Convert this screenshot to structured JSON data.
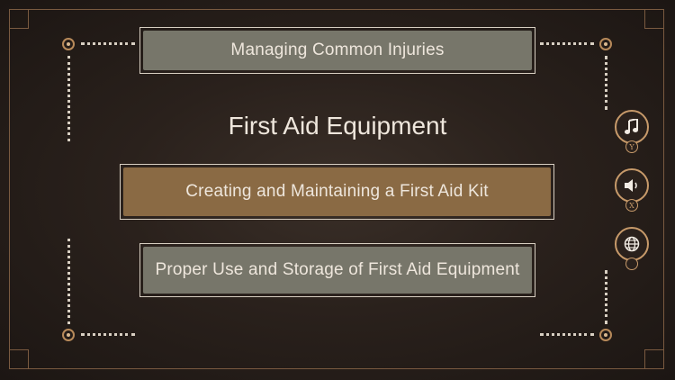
{
  "menu": {
    "category_title": "First Aid Equipment",
    "items": [
      {
        "label": "Managing Common Injuries",
        "state": "partial"
      },
      {
        "label": "Creating and Maintaining a First Aid Kit",
        "state": "selected"
      },
      {
        "label": "Proper Use and Storage of First Aid Equipment",
        "state": "normal"
      }
    ]
  },
  "side_controls": [
    {
      "icon": "music-note-icon",
      "key_hint": "Y"
    },
    {
      "icon": "speaker-icon",
      "key_hint": "X"
    },
    {
      "icon": "globe-icon",
      "key_hint": ""
    }
  ],
  "colors": {
    "background": "#2a211c",
    "accent": "#c79a6a",
    "selected_fill": "#8a6a44",
    "button_fill": "#77766a",
    "text": "#eee6dc"
  }
}
